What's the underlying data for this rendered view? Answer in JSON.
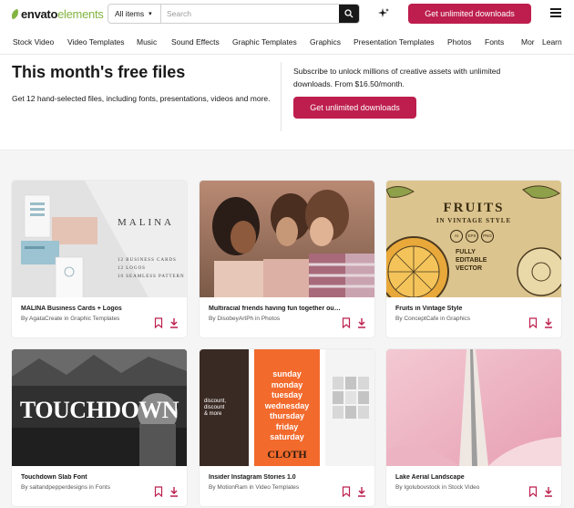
{
  "header": {
    "logo_envato": "envato",
    "logo_elements": "elements",
    "search_scope": "All items",
    "search_placeholder": "Search",
    "cta_label": "Get unlimited downloads"
  },
  "nav": {
    "items": [
      "Stock Video",
      "Video Templates",
      "Music",
      "Sound Effects",
      "Graphic Templates",
      "Graphics",
      "Presentation Templates",
      "Photos",
      "Fonts",
      "Mor",
      "Learn"
    ]
  },
  "hero": {
    "title": "This month's free files",
    "description": "Get 12 hand-selected files, including fonts, presentations, videos and more.",
    "promo_text": "Subscribe to unlock millions of creative assets with unlimited downloads. From $16.50/month.",
    "promo_cta": "Get unlimited downloads"
  },
  "cards": [
    {
      "title": "MALINA Business Cards + Logos",
      "by": "By",
      "author": "AgataCreate",
      "in": "in",
      "category": "Graphic Templates",
      "thumb": {
        "brand": "MALINA",
        "lines": [
          "12 BUSINESS CARDS",
          "12 LOGOS",
          "10 SEAMLESS PATTERN"
        ]
      }
    },
    {
      "title": "Multiracial friends having fun together outdoor -...",
      "by": "By",
      "author": "DisobeyArtPh",
      "in": "in",
      "category": "Photos"
    },
    {
      "title": "Fruits in Vintage Style",
      "by": "By",
      "author": "ConceptCafe",
      "in": "in",
      "category": "Graphics",
      "thumb": {
        "heading": "FRUITS",
        "sub": "IN VINTAGE STYLE",
        "formats": [
          "AI",
          "EPS",
          "PNG"
        ],
        "tag": [
          "FULLY",
          "EDITABLE",
          "VECTOR"
        ]
      }
    },
    {
      "title": "Touchdown Slab Font",
      "by": "By",
      "author": "saltandpepperdesigns",
      "in": "in",
      "category": "Fonts",
      "thumb": {
        "word": "TOUCHDOWN"
      }
    },
    {
      "title": "Insider Instagram Stories 1.0",
      "by": "By",
      "author": "MotionRam",
      "in": "in",
      "category": "Video Templates",
      "thumb": {
        "days": [
          "sunday",
          "monday",
          "tuesday",
          "wednesday",
          "thursday",
          "friday",
          "saturday"
        ],
        "word": "CLOTH",
        "left_text": [
          "discount,",
          "discount",
          "& more"
        ]
      }
    },
    {
      "title": "Lake Aerial Landscape",
      "by": "By",
      "author": "Igolubovstock",
      "in": "in",
      "category": "Stock Video"
    }
  ],
  "colors": {
    "brand_green": "#82b541",
    "cta_red": "#bd1e4d",
    "icon_red": "#bd1e4d",
    "text": "#191919"
  }
}
